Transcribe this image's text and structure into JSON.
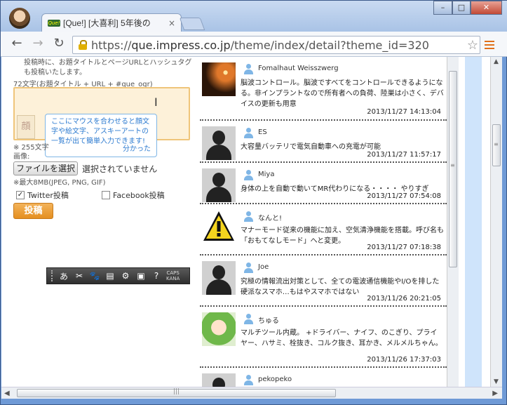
{
  "browser": {
    "tab_title": "[Que!] [大喜利] 5年後の",
    "favicon_text": "Que!",
    "url_prefix": "https://",
    "url_host": "que.impress.co.jp",
    "url_path": "/theme/index/detail?theme_id=320",
    "minimize": "–",
    "maximize": "□",
    "close": "✕",
    "back": "←",
    "forward": "→",
    "reload": "↻",
    "star": "☆"
  },
  "form": {
    "note": "投稿時に、お題タイトルとページURLとハッシュタグも投稿いたします。",
    "char_limit": "72文字(お題タイトル + URL + #que_ogr)",
    "emoji_button": "顔",
    "tooltip_text": "ここにマウスを合わせると顔文字や絵文字、アスキーアートの一覧が出て簡単入力できます!",
    "tooltip_ok": "分かった",
    "remaining": "※ 255文字",
    "image_label": "画像:",
    "file_button": "ファイルを選択",
    "file_none": "選択されていません",
    "file_limit": "※最大8MB(JPEG, PNG, GIF)",
    "twitter_label": "Twitter投稿",
    "twitter_checked": true,
    "facebook_label": "Facebook投稿",
    "facebook_checked": false,
    "post_button": "投稿"
  },
  "ime": {
    "items": [
      "あ",
      "✂",
      "🐾",
      "▤",
      "⚙",
      "▣",
      "?"
    ],
    "caps": "CAPS",
    "kana": "KANA"
  },
  "posts": [
    {
      "user": "Fomalhaut Weisszwerg",
      "avatar": "meteor",
      "text": "脳波コントロール。脳波ですべてをコントロールできるようになる。非インプラントなので所有者への負荷、陸巣は小さく、デバイスの更新も用意",
      "time": "2013/11/27 14:13:04"
    },
    {
      "user": "ES",
      "avatar": "silhouette",
      "text": "大容量バッテリで電気自動車への充電が可能",
      "time": "2013/11/27 11:57:17"
    },
    {
      "user": "Miya",
      "avatar": "silhouette",
      "text": "身体の上を自動で動いてMR代わりになる・・・・ やりすぎ",
      "time": "2013/11/27 07:54:08"
    },
    {
      "user": "なんと!",
      "avatar": "warning",
      "text": "マナーモード従来の機能に加え、空気清浄機能を搭載。呼び名も「おもてなしモード」へと変更。",
      "time": "2013/11/27 07:18:38"
    },
    {
      "user": "Joe",
      "avatar": "silhouette",
      "text": "究極の情報流出対策として、全ての電波通信機能やI/Oを排した硬派なスマホ…もはやスマホではない",
      "time": "2013/11/26 20:21:05"
    },
    {
      "user": "ちゅる",
      "avatar": "anime",
      "text": "マルチツール内蔵。 +ドライバー、ナイフ、のこぎり、プライヤー、ハサミ、栓抜き、コルク抜き、耳かき、メルメルちゃん。",
      "time": "2013/11/26 17:37:03"
    },
    {
      "user": "pekopeko",
      "avatar": "silhouette",
      "text": "",
      "time": ""
    }
  ]
}
